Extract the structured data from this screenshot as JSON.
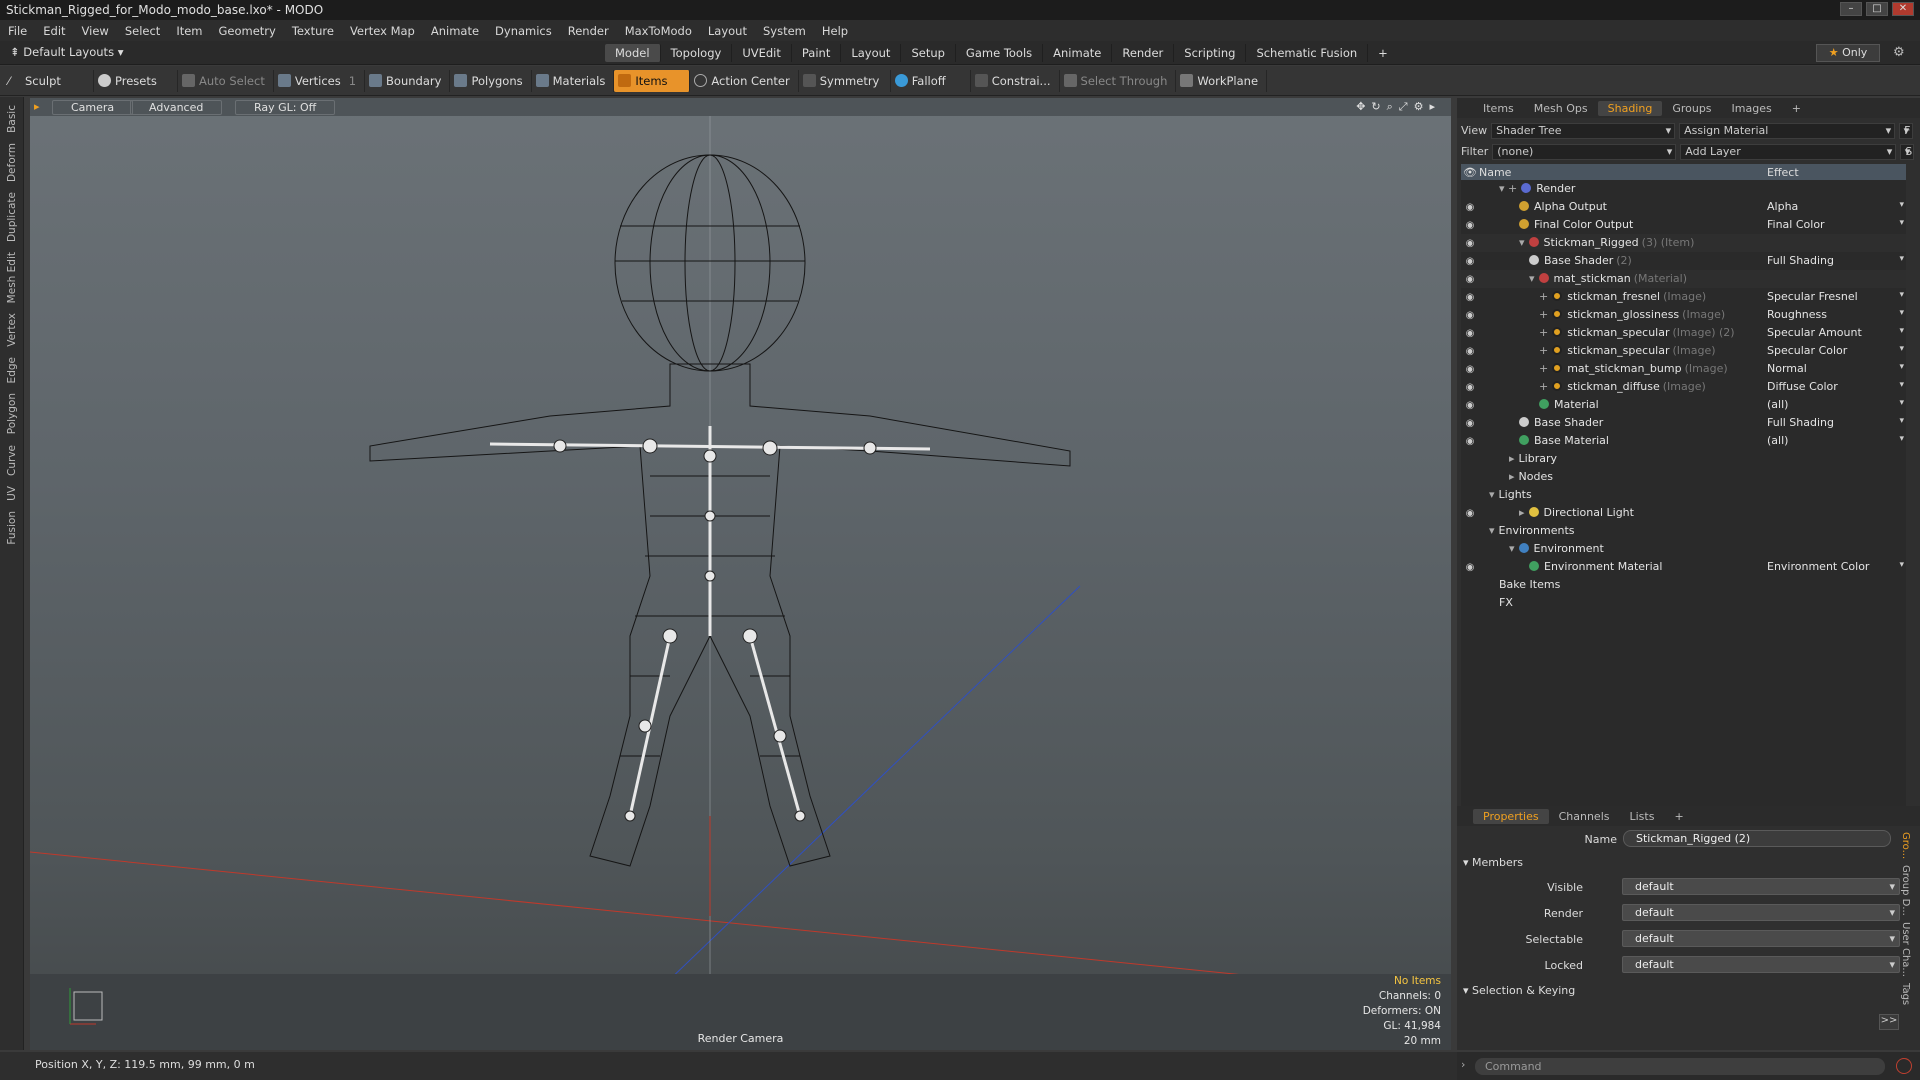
{
  "window": {
    "title": "Stickman_Rigged_for_Modo_modo_base.lxo* - MODO"
  },
  "menu": [
    "File",
    "Edit",
    "View",
    "Select",
    "Item",
    "Geometry",
    "Texture",
    "Vertex Map",
    "Animate",
    "Dynamics",
    "Render",
    "MaxToModo",
    "Layout",
    "System",
    "Help"
  ],
  "layouts": {
    "current": "Default Layouts",
    "tabs": [
      "Model",
      "Topology",
      "UVEdit",
      "Paint",
      "Layout",
      "Setup",
      "Game Tools",
      "Animate",
      "Render",
      "Scripting",
      "Schematic Fusion"
    ],
    "active": "Model",
    "add": "+",
    "only": "Only"
  },
  "toolbar": {
    "sculpt": "Sculpt",
    "presets": "Presets",
    "auto_select": "Auto Select",
    "vertices": "Vertices",
    "vertices_count": "1",
    "boundary": "Boundary",
    "polygons": "Polygons",
    "materials": "Materials",
    "items": "Items",
    "action_center": "Action Center",
    "symmetry": "Symmetry",
    "falloff": "Falloff",
    "constraints": "Constrai...",
    "select_through": "Select Through",
    "workplane": "WorkPlane"
  },
  "left_tabs": [
    "Basic",
    "Deform",
    "Duplicate",
    "Mesh Edit",
    "Vertex",
    "Edge",
    "Polygon",
    "Curve",
    "UV",
    "Fusion"
  ],
  "viewport": {
    "camera": "Camera",
    "advanced": "Advanced",
    "raygl": "Ray GL: Off",
    "info": {
      "items": "No Items",
      "channels": "Channels: 0",
      "deformers": "Deformers: ON",
      "gl": "GL: 41,984",
      "lens": "20 mm"
    },
    "render_camera": "Render Camera"
  },
  "status": {
    "position": "Position X, Y, Z:  119.5 mm, 99 mm, 0 m"
  },
  "shading": {
    "tabs": [
      "Items",
      "Mesh Ops",
      "Shading",
      "Groups",
      "Images",
      "+"
    ],
    "active_tab": "Shading",
    "view_label": "View",
    "view_value": "Shader Tree",
    "assign": "Assign Material",
    "assign_btn": "F",
    "filter_label": "Filter",
    "filter_value": "(none)",
    "add_layer": "Add Layer",
    "add_btn": "S",
    "columns": {
      "name": "Name",
      "effect": "Effect"
    },
    "rows": [
      {
        "name": "Render",
        "sub": "",
        "effect": "",
        "eye": false
      },
      {
        "name": "Alpha Output",
        "sub": "",
        "effect": "Alpha",
        "eye": true
      },
      {
        "name": "Final Color Output",
        "sub": "",
        "effect": "Final Color",
        "eye": true
      },
      {
        "name": "Stickman_Rigged",
        "sub": "(3) (Item)",
        "effect": "",
        "eye": true
      },
      {
        "name": "Base Shader",
        "sub": "(2)",
        "effect": "Full Shading",
        "eye": true
      },
      {
        "name": "mat_stickman",
        "sub": "(Material)",
        "effect": "",
        "eye": true
      },
      {
        "name": "stickman_fresnel",
        "sub": "(Image)",
        "effect": "Specular Fresnel",
        "eye": true
      },
      {
        "name": "stickman_glossiness",
        "sub": "(Image)",
        "effect": "Roughness",
        "eye": true
      },
      {
        "name": "stickman_specular",
        "sub": "(Image) (2)",
        "effect": "Specular Amount",
        "eye": true
      },
      {
        "name": "stickman_specular",
        "sub": "(Image)",
        "effect": "Specular Color",
        "eye": true
      },
      {
        "name": "mat_stickman_bump",
        "sub": "(Image)",
        "effect": "Normal",
        "eye": true
      },
      {
        "name": "stickman_diffuse",
        "sub": "(Image)",
        "effect": "Diffuse Color",
        "eye": true
      },
      {
        "name": "Material",
        "sub": "",
        "effect": "(all)",
        "eye": true
      },
      {
        "name": "Base Shader",
        "sub": "",
        "effect": "Full Shading",
        "eye": true
      },
      {
        "name": "Base Material",
        "sub": "",
        "effect": "(all)",
        "eye": true
      },
      {
        "name": "Library",
        "sub": "",
        "effect": "",
        "eye": false
      },
      {
        "name": "Nodes",
        "sub": "",
        "effect": "",
        "eye": false
      },
      {
        "name": "Lights",
        "sub": "",
        "effect": "",
        "eye": false
      },
      {
        "name": "Directional Light",
        "sub": "",
        "effect": "",
        "eye": true
      },
      {
        "name": "Environments",
        "sub": "",
        "effect": "",
        "eye": false
      },
      {
        "name": "Environment",
        "sub": "",
        "effect": "",
        "eye": false
      },
      {
        "name": "Environment Material",
        "sub": "",
        "effect": "Environment Color",
        "eye": true
      },
      {
        "name": "Bake Items",
        "sub": "",
        "effect": "",
        "eye": false
      },
      {
        "name": "FX",
        "sub": "",
        "effect": "",
        "eye": false
      }
    ]
  },
  "properties": {
    "tabs": [
      "Properties",
      "Channels",
      "Lists",
      "+"
    ],
    "active_tab": "Properties",
    "name_label": "Name",
    "name_value": "Stickman_Rigged (2)",
    "members": "Members",
    "fields": [
      {
        "label": "Visible",
        "value": "default"
      },
      {
        "label": "Render",
        "value": "default"
      },
      {
        "label": "Selectable",
        "value": "default"
      },
      {
        "label": "Locked",
        "value": "default"
      }
    ],
    "selection_keying": "Selection & Keying",
    "side_tabs": [
      "Gro...",
      "Group D...",
      "User Cha...",
      "Tags"
    ],
    "more": ">>"
  },
  "command": {
    "placeholder": "Command"
  }
}
